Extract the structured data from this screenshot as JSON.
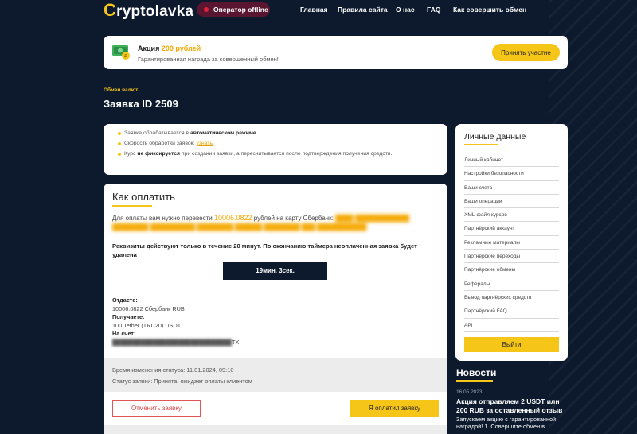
{
  "header": {
    "logo_prefix": "C",
    "logo_text": "ryptolavka",
    "operator_status": "Оператор offline",
    "nav": [
      "Главная",
      "Правила сайта",
      "О нас",
      "FAQ",
      "Как совершить обмен"
    ]
  },
  "promo": {
    "title_prefix": "Акция ",
    "title_amount": "200 рублей",
    "subtitle": "Гарантированная награда за совершенный обмен!",
    "button": "Принять участие",
    "icon": "money-icon"
  },
  "page": {
    "breadcrumb": "Обмен валют",
    "title": "Заявка ID 2509"
  },
  "info": {
    "line1_text": "Заявка обрабатывается в ",
    "line1_bold": "автоматическом режиме",
    "line1_end": ".",
    "line2_text": "Скорость обработки заявок: ",
    "line2_link": "узнать",
    "line2_end": ".",
    "line3_start": "Курс ",
    "line3_bold": "не фиксируется",
    "line3_rest": " при создании заявки, а пересчитывается после подтверждения получения средств."
  },
  "payment": {
    "title": "Как оплатить",
    "text_start": "Для оплаты вам нужно перевести ",
    "amount": "10006.0822",
    "text_mid": " рублей на карту Сбербанк:",
    "warning": "Реквизиты действуют только в течение 20 минут. По окончанию таймера неоплаченная заявка будет удалена",
    "timer": "19мин. 3сек.",
    "give_label": "Отдаете:",
    "give_value": "10006.0822 Сбербанк RUB",
    "get_label": "Получаете:",
    "get_value": "100 Tether (TRC20) USDT",
    "account_label": "На счет:",
    "account_suffix": "TX",
    "status_time": "Время изменения статуса: 11.01.2024, 09:10",
    "status_text": "Статус заявки: Принята, ожидает оплаты клиентом",
    "cancel_button": "Отменить заявку",
    "paid_button": "Я оплатил заявку"
  },
  "sidebar": {
    "title": "Личные данные",
    "items": [
      "Личный кабинет",
      "Настройки безопасности",
      "Ваши счета",
      "Ваши операции",
      "XML-файл курсов",
      "Партнёрский аккаунт",
      "Рекламные материалы",
      "Партнёрские переходы",
      "Партнёрские обмены",
      "Рефералы",
      "Вывод партнёрских средств",
      "Партнёрский FAQ",
      "API"
    ],
    "logout": "Выйти"
  },
  "news": {
    "title": "Новости",
    "date": "16.05.2023",
    "headline": "Акция отправляем 2 USDT или 200 RUB за оставленный отзыв",
    "body": "Запускаем акцию с гарантированной наградой! 1. Совершите обмен в ..."
  },
  "colors": {
    "accent": "#f5c518",
    "background": "#0d1a2e",
    "danger": "#e05555"
  }
}
